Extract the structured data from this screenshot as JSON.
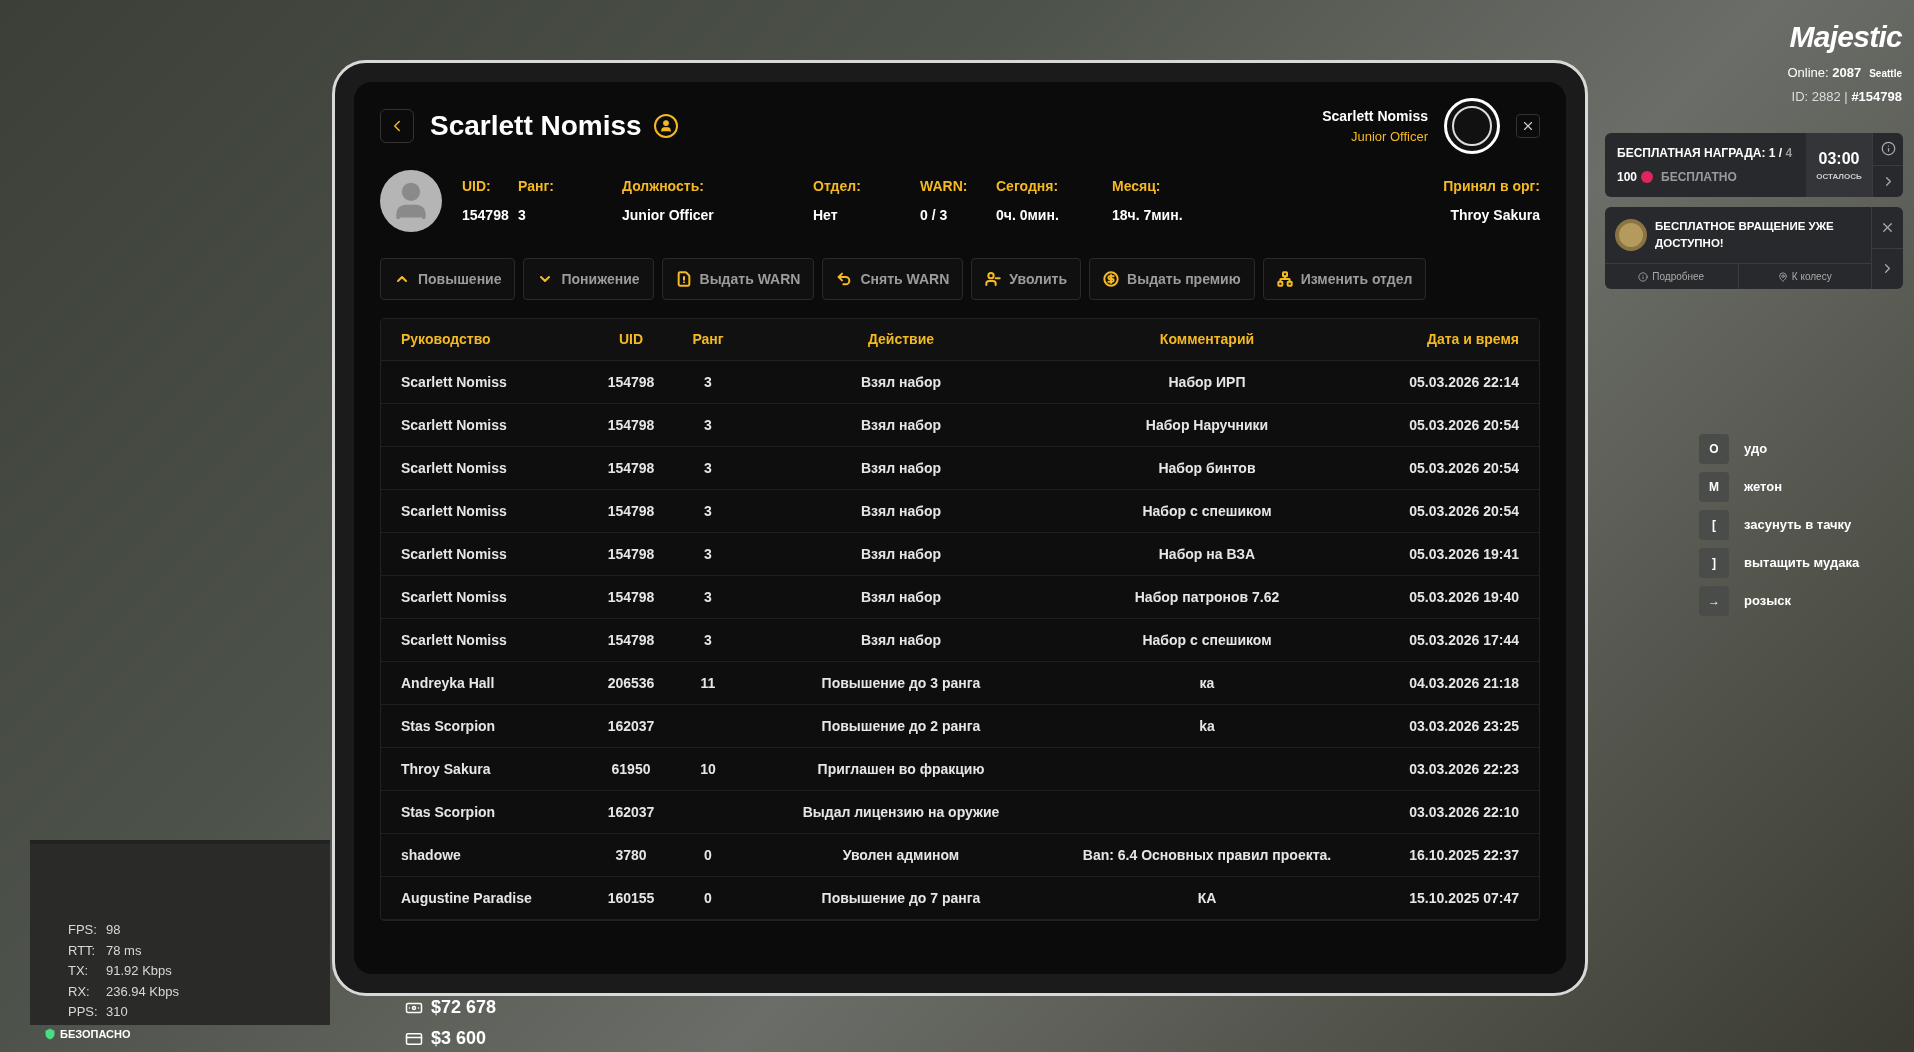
{
  "hud": {
    "logo": "Majestic",
    "online_label": "Online:",
    "online": "2087",
    "server": "Seattle",
    "id_label": "ID: 2882 |",
    "account": "#154798"
  },
  "reward": {
    "title": "БЕСПЛАТНАЯ НАГРАДА: 1 /",
    "total": "4",
    "amount": "100",
    "price": "БЕСПЛАТНО",
    "timer": "03:00",
    "timer_label": "ОСТАЛОСЬ"
  },
  "wheel": {
    "text": "БЕСПЛАТНОЕ ВРАЩЕНИЕ УЖЕ ДОСТУПНО!",
    "links": [
      {
        "kind": "info",
        "label": "Подробнее"
      },
      {
        "kind": "location",
        "label": "К колесу"
      }
    ]
  },
  "keybinds": [
    {
      "key": "O",
      "label": "удо"
    },
    {
      "key": "M",
      "label": "жетон"
    },
    {
      "key": "[",
      "label": "засунуть в тачку"
    },
    {
      "key": "]",
      "label": "вытащить мудака"
    },
    {
      "key": "→",
      "label": "розыск"
    }
  ],
  "stats": [
    {
      "label": "FPS:",
      "value": "98"
    },
    {
      "label": "RTT:",
      "value": "78 ms"
    },
    {
      "label": "TX:",
      "value": "91.92 Kbps"
    },
    {
      "label": "RX:",
      "value": "236.94 Kbps"
    },
    {
      "label": "PPS:",
      "value": "310"
    }
  ],
  "zone": "БЕЗОПАСНО",
  "money": [
    {
      "kind": "cash",
      "amount": "$72 678"
    },
    {
      "kind": "card",
      "amount": "$3 600"
    }
  ],
  "tablet": {
    "title": "Scarlett Nomiss",
    "user": {
      "name": "Scarlett Nomiss",
      "role": "Junior Officer"
    },
    "fields": [
      {
        "label": "UID:",
        "value": "154798"
      },
      {
        "label": "Ранг:",
        "value": "3"
      },
      {
        "label": "Должность:",
        "value": "Junior Officer"
      },
      {
        "label": "Отдел:",
        "value": "Нет"
      },
      {
        "label": "WARN:",
        "value": "0 / 3"
      },
      {
        "label": "Сегодня:",
        "value": "0ч. 0мин."
      },
      {
        "label": "Месяц:",
        "value": "18ч. 7мин."
      },
      {
        "label": "Принял в орг:",
        "value": "Throy Sakura"
      }
    ],
    "actions": [
      {
        "kind": "promote",
        "label": "Повышение"
      },
      {
        "kind": "demote",
        "label": "Понижение"
      },
      {
        "kind": "warn",
        "label": "Выдать WARN"
      },
      {
        "kind": "unwarn",
        "label": "Снять WARN"
      },
      {
        "kind": "fire",
        "label": "Уволить"
      },
      {
        "kind": "bonus",
        "label": "Выдать премию"
      },
      {
        "kind": "department",
        "label": "Изменить отдел"
      }
    ],
    "columns": [
      "Руководство",
      "UID",
      "Ранг",
      "Действие",
      "Комментарий",
      "Дата и время"
    ],
    "rows": [
      [
        "Scarlett Nomiss",
        "154798",
        "3",
        "Взял набор",
        "Набор ИРП",
        "05.03.2026 22:14"
      ],
      [
        "Scarlett Nomiss",
        "154798",
        "3",
        "Взял набор",
        "Набор Наручники",
        "05.03.2026 20:54"
      ],
      [
        "Scarlett Nomiss",
        "154798",
        "3",
        "Взял набор",
        "Набор бинтов",
        "05.03.2026 20:54"
      ],
      [
        "Scarlett Nomiss",
        "154798",
        "3",
        "Взял набор",
        "Набор с спешиком",
        "05.03.2026 20:54"
      ],
      [
        "Scarlett Nomiss",
        "154798",
        "3",
        "Взял набор",
        "Набор на ВЗА",
        "05.03.2026 19:41"
      ],
      [
        "Scarlett Nomiss",
        "154798",
        "3",
        "Взял набор",
        "Набор патронов 7.62",
        "05.03.2026 19:40"
      ],
      [
        "Scarlett Nomiss",
        "154798",
        "3",
        "Взял набор",
        "Набор с спешиком",
        "05.03.2026 17:44"
      ],
      [
        "Andreyka Hall",
        "206536",
        "11",
        "Повышение до 3 ранга",
        "ка",
        "04.03.2026 21:18"
      ],
      [
        "Stas Scorpion",
        "162037",
        "",
        "Повышение до 2 ранга",
        "ka",
        "03.03.2026 23:25"
      ],
      [
        "Throy Sakura",
        "61950",
        "10",
        "Приглашен во фракцию",
        "",
        "03.03.2026 22:23"
      ],
      [
        "Stas Scorpion",
        "162037",
        "",
        "Выдал лицензию на оружие",
        "",
        "03.03.2026 22:10"
      ],
      [
        "shadowe",
        "3780",
        "0",
        "Уволен админом",
        "Ban: 6.4 Основных правил проекта.",
        "16.10.2025 22:37"
      ],
      [
        "Augustine Paradise",
        "160155",
        "0",
        "Повышение до 7 ранга",
        "КА",
        "15.10.2025 07:47"
      ]
    ]
  }
}
